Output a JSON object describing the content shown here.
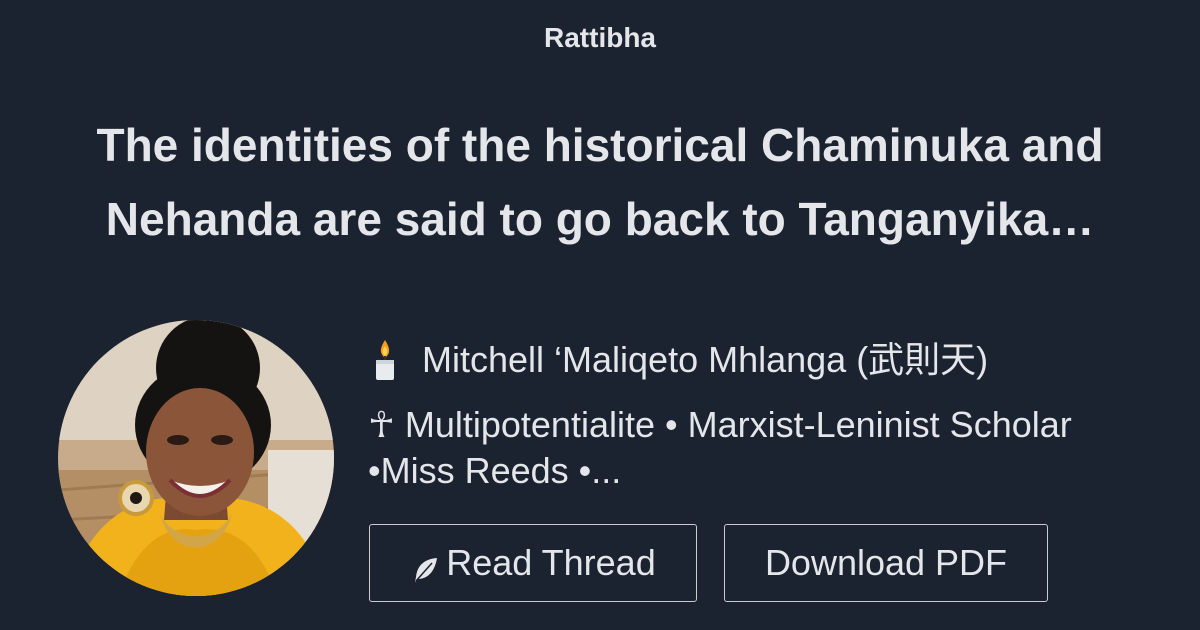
{
  "site": {
    "brand": "Rattibha"
  },
  "thread": {
    "title_line1": "The identities of the historical Chaminuka and",
    "title_line2": "Nehanda are said to go back to Tanganyika…"
  },
  "author": {
    "emoji_icon": "candle-icon",
    "name": "Mitchell ‘Maliqeto Mhlanga (武則天)",
    "bio_line1": "☥ Multipotentialite • Marxist-Leninist Scholar",
    "bio_line2": "•Miss Reeds •..."
  },
  "actions": {
    "read_label": "Read Thread",
    "read_icon": "feather-icon",
    "pdf_label": "Download PDF"
  },
  "colors": {
    "background": "#1b2230",
    "text": "#e4e6ea",
    "button_border": "#c8ccd3"
  }
}
